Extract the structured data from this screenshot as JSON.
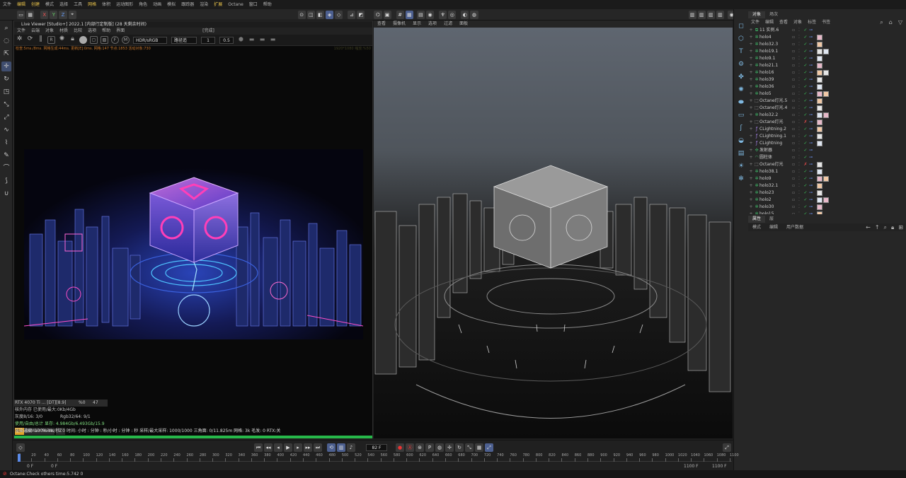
{
  "menubar": {
    "items": [
      "文件",
      "编辑",
      "创建",
      "模式",
      "选择",
      "工具",
      "网格",
      "体积",
      "运动图形",
      "角色",
      "动画",
      "模拟",
      "跟踪器",
      "渲染",
      "扩展",
      "Octane",
      "窗口",
      "帮助"
    ],
    "highlighted": [
      "编辑",
      "创建",
      "网格",
      "扩展"
    ]
  },
  "toolbar": {
    "axis_labels": [
      "X",
      "Y",
      "Z"
    ]
  },
  "live_viewer": {
    "title": "Live Viewer [Studio+] 2022.1 [内部行定制版] (28 天剩余时间)",
    "status_tag": "[完成]",
    "menu": [
      "文件",
      "云端",
      "对象",
      "材质",
      "比较",
      "选项",
      "帮助",
      "界面"
    ],
    "color_space": "HDR/sRGB",
    "mode": "路径追",
    "value1": "1",
    "value2": "0.5",
    "stats": "检查:5ms./8ms. 网格生成:44ms. 更新[E]:0ms. 网格:147 节点:1853 活动对象:730",
    "resolution": "1920*1080 缩放:%50",
    "info": {
      "gpu": "RTX 4070 Ti ... [DT][8.9]",
      "gpu_pct": "%0",
      "gpu_temp": "47",
      "mem_out": "核外内存 已使用/最大:0Kb/4Gb",
      "grey": "灰度8/16: 3/0",
      "rgb": "Rgb32/64: 9/1",
      "vram": "使用/自由/总计 显存: 4.984Gb/6.493Gb/15.9",
      "denoise_tag": "Mai",
      "denoise": "DeMair Noise",
      "z": "Z"
    },
    "bottom_status": "渲染进度: 100%   Ms/秒: 0   时间: 小时 : 分钟 : 秒/小时 : 分钟 : 秒   采样/最大采样: 1000/1000   三角面: 0/11.825m   网格: 3k   毛发: 0   RTX:关",
    "progress": 1.0
  },
  "viewport": {
    "menu": [
      "查看",
      "摄像机",
      "显示",
      "选项",
      "过滤",
      "面板"
    ]
  },
  "object_manager": {
    "tabs": [
      "对象",
      "场次"
    ],
    "menu": [
      "文件",
      "编辑",
      "查看",
      "对象",
      "标签",
      "书签"
    ],
    "objects": [
      {
        "name": "11 实例.6",
        "icon": "instance",
        "check": "✓"
      },
      {
        "name": "holo4",
        "icon": "star",
        "check": "✓"
      },
      {
        "name": "holo32.3",
        "icon": "star",
        "check": "✓"
      },
      {
        "name": "holo19.1",
        "icon": "star",
        "check": "✓"
      },
      {
        "name": "holo9.1",
        "icon": "star",
        "check": "✓"
      },
      {
        "name": "holo21.1",
        "icon": "star",
        "check": "✓"
      },
      {
        "name": "holo16",
        "icon": "star",
        "check": "✓"
      },
      {
        "name": "holo39",
        "icon": "star",
        "check": "✓"
      },
      {
        "name": "holo36",
        "icon": "star",
        "check": "✓"
      },
      {
        "name": "holo5",
        "icon": "star",
        "check": "✓"
      },
      {
        "name": "Octane灯光.5",
        "icon": "light",
        "check": "✓"
      },
      {
        "name": "Octane灯光.4",
        "icon": "light",
        "check": "✓"
      },
      {
        "name": "holo32.2",
        "icon": "star",
        "check": "✓"
      },
      {
        "name": "Octane灯光",
        "icon": "light",
        "check": "✗"
      },
      {
        "name": "CLightning.2",
        "icon": "fx",
        "check": "✓"
      },
      {
        "name": "CLightning.1",
        "icon": "fx",
        "check": "✓"
      },
      {
        "name": "CLightning",
        "icon": "fx",
        "check": "✓"
      },
      {
        "name": "发射器",
        "icon": "emitter",
        "check": "✓"
      },
      {
        "name": "圆柱体",
        "icon": "shape",
        "check": "✓"
      },
      {
        "name": "Octane灯光",
        "icon": "light",
        "check": "✗"
      },
      {
        "name": "holo38.1",
        "icon": "star",
        "check": "✓"
      },
      {
        "name": "holo9",
        "icon": "star",
        "check": "✓"
      },
      {
        "name": "holo32.1",
        "icon": "star",
        "check": "✓"
      },
      {
        "name": "holo23",
        "icon": "star",
        "check": "✓"
      },
      {
        "name": "holo2",
        "icon": "star",
        "check": "✓"
      },
      {
        "name": "holo30",
        "icon": "star",
        "check": "✓"
      },
      {
        "name": "holo15",
        "icon": "star",
        "check": "✓"
      }
    ]
  },
  "attributes": {
    "tabs": [
      "属性",
      "层"
    ],
    "menu": [
      "模式",
      "编辑",
      "用户数据"
    ]
  },
  "timeline": {
    "ticks": [
      "0",
      "20",
      "40",
      "60",
      "80",
      "100",
      "120",
      "140",
      "160",
      "180",
      "200",
      "220",
      "240",
      "260",
      "280",
      "300",
      "320",
      "340",
      "360",
      "380",
      "400",
      "420",
      "440",
      "460",
      "480",
      "500",
      "520",
      "540",
      "560",
      "580",
      "600",
      "620",
      "640",
      "660",
      "680",
      "700",
      "720",
      "740",
      "760",
      "780",
      "800",
      "820",
      "840",
      "860",
      "880",
      "900",
      "920",
      "940",
      "960",
      "980",
      "1000",
      "1020",
      "1040",
      "1060",
      "1080",
      "1100"
    ],
    "current_frame": "82 F",
    "start_a": "0 F",
    "start_b": "0 F",
    "end_a": "1100 F",
    "end_b": "1100 F"
  },
  "status": {
    "message": "Octane:Check others time:5.742  0"
  }
}
